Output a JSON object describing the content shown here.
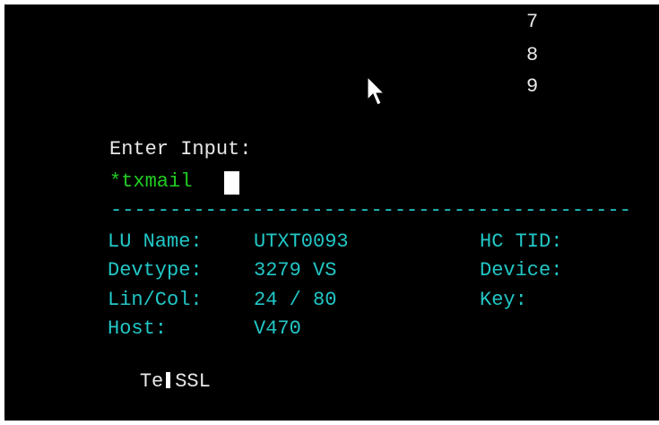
{
  "menu_numbers": [
    "7",
    "8",
    "9"
  ],
  "prompt": {
    "label": "Enter Input:",
    "value": "*txmail"
  },
  "divider": "--------------------------------------------",
  "session_info": {
    "lu_name_label": "LU Name:",
    "lu_name_value": "UTXT0093",
    "devtype_label": "Devtype:",
    "devtype_value": "3279 VS",
    "lincol_label": "Lin/Col:",
    "lincol_value": "24 / 80",
    "host_label": "Host:",
    "host_value": "V470",
    "hc_tid_label": "HC TID:",
    "device_label": "Device:",
    "key_label": "Key:"
  },
  "status_line": {
    "prefix": "Te",
    "ssl": "SSL"
  },
  "colors": {
    "background": "#000000",
    "white_text": "#e8e8e8",
    "green_input": "#22cc22",
    "cyan_info": "#22c7c7"
  },
  "icons": [
    "mouse-pointer-icon",
    "text-cursor-block"
  ]
}
